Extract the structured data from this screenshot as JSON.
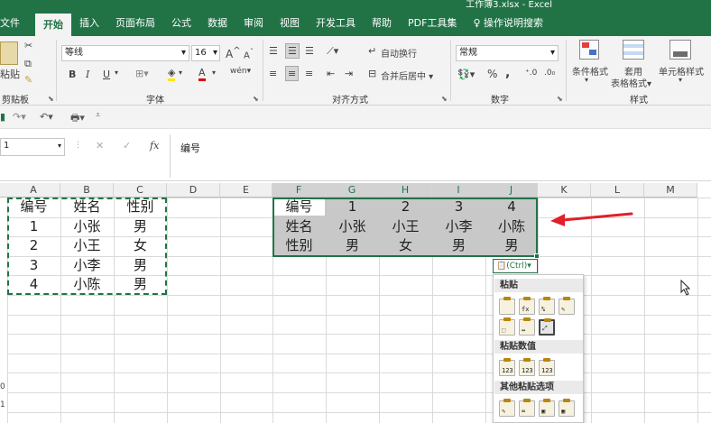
{
  "window": {
    "title": "工作簿3.xlsx - Excel"
  },
  "tabs": [
    {
      "label": "文件",
      "active": false
    },
    {
      "label": "开始",
      "active": true
    },
    {
      "label": "插入",
      "active": false
    },
    {
      "label": "页面布局",
      "active": false
    },
    {
      "label": "公式",
      "active": false
    },
    {
      "label": "数据",
      "active": false
    },
    {
      "label": "审阅",
      "active": false
    },
    {
      "label": "视图",
      "active": false
    },
    {
      "label": "开发工具",
      "active": false
    },
    {
      "label": "帮助",
      "active": false
    },
    {
      "label": "PDF工具集",
      "active": false
    }
  ],
  "tell_me": "操作说明搜索",
  "ribbon": {
    "paste_label": "粘贴",
    "font_name": "等线",
    "font_size": "16",
    "wrap_text": "自动换行",
    "merge_center": "合并后居中",
    "number_format": "常规",
    "percent": "%",
    "comma": ",",
    "bold": "B",
    "italic": "I",
    "underline": "U",
    "font_color_glyph": "A",
    "highlight_glyph": "A",
    "grow_font": "A",
    "shrink_font": "A",
    "phonetic": "wén",
    "cond_format": "条件格式",
    "table_format_1": "套用",
    "table_format_2": "表格格式",
    "cell_style": "单元格样式",
    "groups": {
      "clipboard": "剪贴板",
      "font": "字体",
      "alignment": "对齐方式",
      "number": "数字",
      "styles": "样式"
    }
  },
  "formula_bar": {
    "name_box": "1",
    "fx": "fx",
    "content": "编号"
  },
  "columns": [
    "A",
    "B",
    "C",
    "D",
    "E",
    "F",
    "G",
    "H",
    "I",
    "J",
    "K",
    "L",
    "M"
  ],
  "selected_columns": [
    "F",
    "G",
    "H",
    "I",
    "J"
  ],
  "source_table": [
    [
      "编号",
      "姓名",
      "性别"
    ],
    [
      "1",
      "小张",
      "男"
    ],
    [
      "2",
      "小王",
      "女"
    ],
    [
      "3",
      "小李",
      "男"
    ],
    [
      "4",
      "小陈",
      "男"
    ]
  ],
  "transposed_table": [
    [
      "编号",
      "1",
      "2",
      "3",
      "4"
    ],
    [
      "姓名",
      "小张",
      "小王",
      "小李",
      "小陈"
    ],
    [
      "性别",
      "男",
      "女",
      "男",
      "男"
    ]
  ],
  "row_numbers_visible": [
    "0",
    "1"
  ],
  "ctrl_button": "(Ctrl)",
  "paste_menu": {
    "header_paste": "粘贴",
    "header_values": "粘贴数值",
    "header_other": "其他粘贴选项",
    "value_num": "123"
  },
  "colors": {
    "excel_green": "#217346",
    "arrow_red": "#e0202a",
    "selection_fill": "#c8c8c8",
    "selection_border": "#217346"
  }
}
